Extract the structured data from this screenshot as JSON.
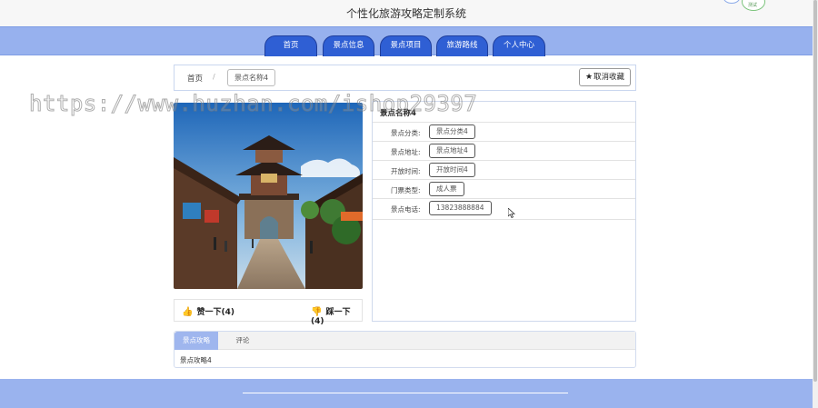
{
  "site": {
    "title": "个性化旅游攻略定制系统",
    "badge_text": "测试"
  },
  "nav": {
    "items": [
      {
        "label": "首页"
      },
      {
        "label": "景点信息"
      },
      {
        "label": "景点项目"
      },
      {
        "label": "旅游路线"
      },
      {
        "label": "个人中心"
      }
    ]
  },
  "breadcrumb": {
    "home": "首页",
    "separator": "/",
    "current": "景点名称4"
  },
  "actions": {
    "unfavorite_label": "取消收藏",
    "unfavorite_icon": "star-icon"
  },
  "spot": {
    "name": "景点名称4",
    "fields": [
      {
        "label": "景点分类:",
        "value": "景点分类4"
      },
      {
        "label": "景点地址:",
        "value": "景点地址4"
      },
      {
        "label": "开放时间:",
        "value": "开放时间4"
      },
      {
        "label": "门票类型:",
        "value": "成人票"
      },
      {
        "label": "景点电话:",
        "value": "13823888884"
      }
    ]
  },
  "votes": {
    "up_label": "赞一下(4)",
    "up_icon": "thumbs-up-icon",
    "down_label": "踩一下(4)",
    "down_icon": "thumbs-down-icon"
  },
  "tabs": {
    "items": [
      {
        "label": "景点攻略"
      },
      {
        "label": "评论"
      }
    ],
    "active_content": "景点攻略4"
  },
  "watermark": "https://www.huzhan.com/ishop29397",
  "colors": {
    "nav_band": "#97b1ee",
    "nav_tab": "#2f5fd4",
    "footer": "#9ab3ee",
    "active_tab": "#9fb6ee",
    "vote_icon": "#e53935"
  }
}
